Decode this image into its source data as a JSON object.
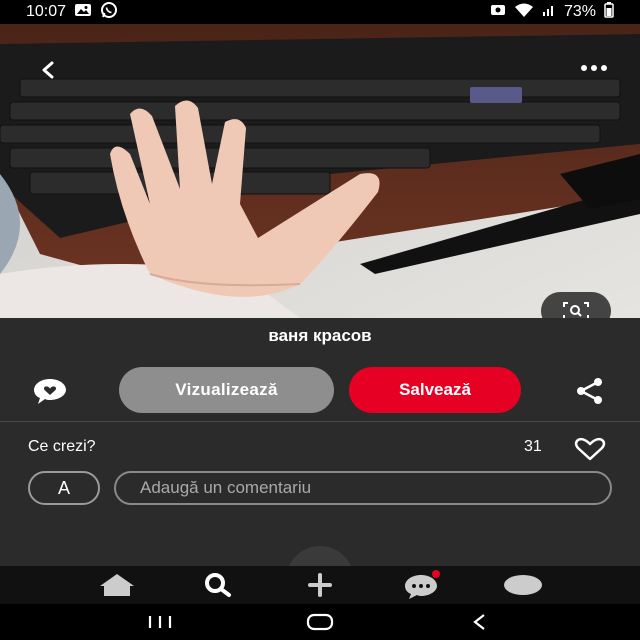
{
  "status_bar": {
    "time": "10:07",
    "battery": "73%"
  },
  "post": {
    "author": "ваня красов",
    "view_label": "Vizualizează",
    "save_label": "Salvează"
  },
  "comments": {
    "prompt": "Ce crezi?",
    "like_count": "31",
    "avatar_letter": "A",
    "input_placeholder": "Adaugă un comentariu"
  },
  "icons": {
    "back": "chevron-left-icon",
    "more": "more-dots-icon",
    "lens": "visual-search-icon",
    "comment": "chat-heart-icon",
    "share": "share-icon",
    "heart": "heart-outline-icon",
    "nav": [
      "home-icon",
      "search-icon",
      "plus-icon",
      "messages-icon",
      "profile-icon"
    ],
    "system_nav": [
      "recents-icon",
      "home-pill-icon",
      "back-icon"
    ]
  },
  "colors": {
    "save_red": "#e60023",
    "view_gray": "#8e8e8e",
    "background": "#2b2b2b",
    "notification_dot": "#e60023"
  }
}
